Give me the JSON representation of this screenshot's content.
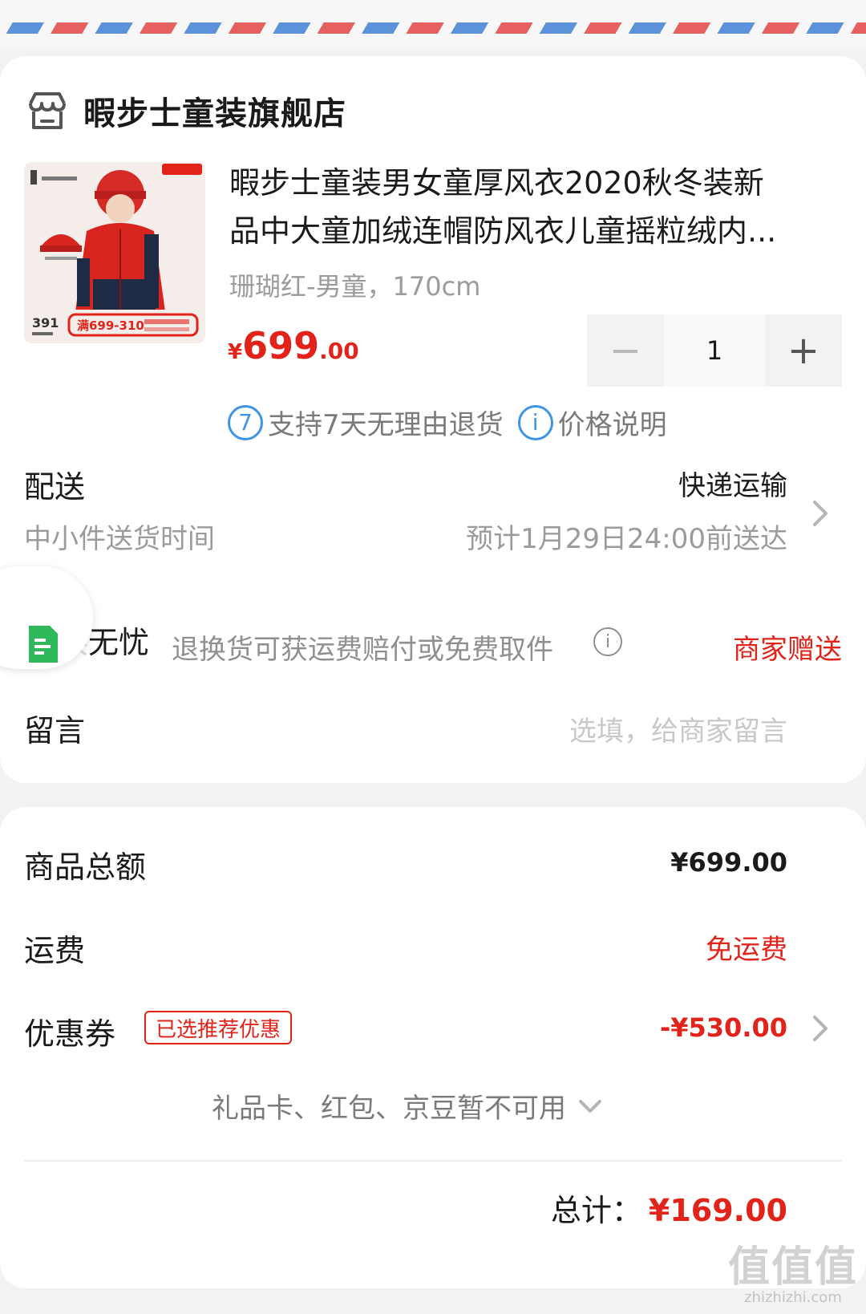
{
  "colors": {
    "accent_red": "#e2231a",
    "info_blue": "#3f94e6",
    "airmail_red": "#e5605e",
    "airmail_blue": "#5b92d9",
    "green_icon": "#2fb85a"
  },
  "store": {
    "icon": "store-icon",
    "name": "暇步士童装旗舰店"
  },
  "product": {
    "image_badge": "391",
    "image_promo": "满699-310",
    "title_line1": "暇步士童装男女童厚风衣2020秋冬装新",
    "title_line2": "品中大童加绒连帽防风衣儿童摇粒绒内...",
    "spec": "珊瑚红-男童，170cm",
    "price_symbol": "¥",
    "price_int": "699",
    "price_dec": ".00",
    "quantity": "1",
    "minus_label": "−",
    "plus_label": "+"
  },
  "services": {
    "return_icon_text": "7",
    "return_text": "支持7天无理由退货",
    "price_icon_text": "i",
    "price_text": "价格说明"
  },
  "delivery": {
    "label": "配送",
    "method": "快递运输",
    "sub_label": "中小件送货时间",
    "estimate": "预计1月29日24:00前送达"
  },
  "worry_free": {
    "ghost_text": "换",
    "label": "无忧",
    "desc": "退换货可获运费赔付或免费取件",
    "info_icon_text": "i",
    "gift": "商家赠送"
  },
  "message": {
    "label": "留言",
    "placeholder": "选填，给商家留言"
  },
  "summary": {
    "goods_total_label": "商品总额",
    "goods_total_value": "¥699.00",
    "shipping_label": "运费",
    "shipping_value": "免运费",
    "coupon_label": "优惠券",
    "coupon_tag": "已选推荐优惠",
    "coupon_value": "-¥530.00",
    "unavailable_text": "礼品卡、红包、京豆暂不可用",
    "total_label": "总计：",
    "total_value": "¥169.00"
  },
  "watermark": {
    "main": "值值值",
    "sub": "zhizhizhi.com"
  }
}
